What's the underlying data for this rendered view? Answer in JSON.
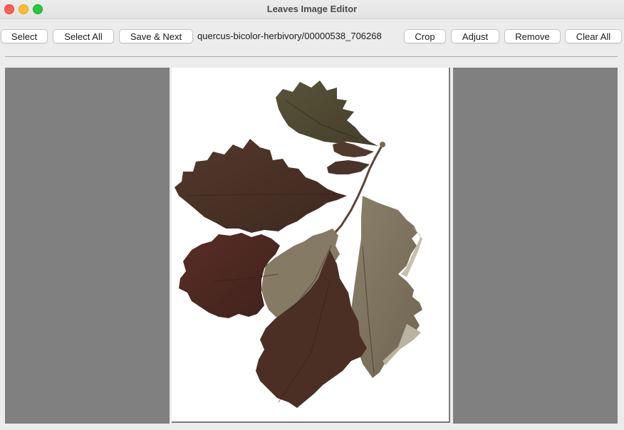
{
  "window": {
    "title": "Leaves Image Editor"
  },
  "toolbar": {
    "select_label": "Select",
    "select_all_label": "Select All",
    "save_next_label": "Save & Next",
    "image_path": "quercus-bicolor-herbivory/00000538_706268",
    "crop_label": "Crop",
    "adjust_label": "Adjust",
    "remove_label": "Remove",
    "clear_all_label": "Clear All"
  },
  "colors": {
    "side_panel": "#808080",
    "canvas_bg": "#ffffff",
    "leaf_dark": "#4a3328",
    "leaf_olive": "#4f4a33",
    "leaf_tan": "#7d735f",
    "leaf_redbrown": "#4d2a22"
  },
  "image": {
    "subject": "pressed-oak-leaves"
  }
}
